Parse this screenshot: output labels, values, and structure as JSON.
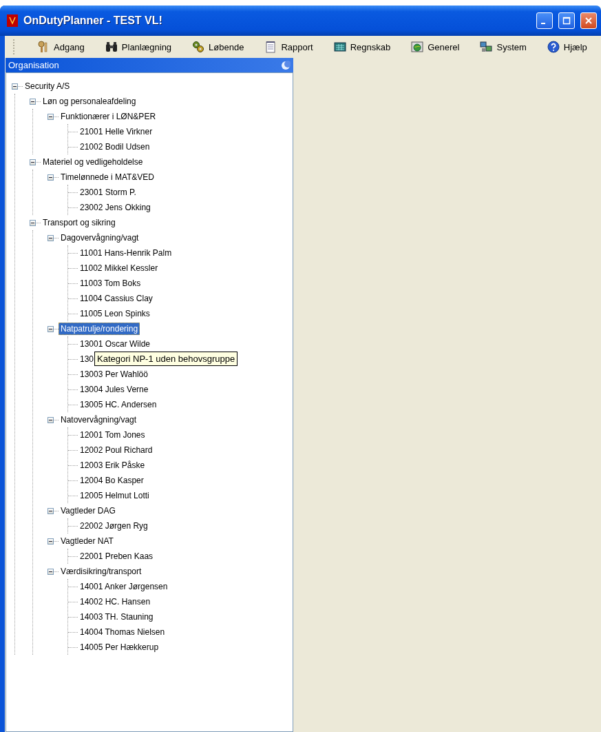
{
  "window": {
    "title": "OnDutyPlanner - TEST VL!"
  },
  "menu": [
    {
      "label": "Adgang"
    },
    {
      "label": "Planlægning"
    },
    {
      "label": "Løbende"
    },
    {
      "label": "Rapport"
    },
    {
      "label": "Regnskab"
    },
    {
      "label": "Generel"
    },
    {
      "label": "System"
    },
    {
      "label": "Hjælp"
    }
  ],
  "panel": {
    "title": "Organisation"
  },
  "tree": [
    {
      "label": "Security A/S",
      "expanded": true,
      "selected": false,
      "children": [
        {
          "label": "Løn og personaleafdeling",
          "expanded": true,
          "selected": false,
          "children": [
            {
              "label": "Funktionærer i LØN&PER",
              "expanded": true,
              "selected": false,
              "children": [
                {
                  "label": "21001 Helle Virkner",
                  "selected": false
                },
                {
                  "label": "21002 Bodil Udsen",
                  "selected": false
                }
              ]
            }
          ]
        },
        {
          "label": "Materiel og vedligeholdelse",
          "expanded": true,
          "selected": false,
          "children": [
            {
              "label": "Timelønnede i MAT&VED",
              "expanded": true,
              "selected": false,
              "children": [
                {
                  "label": "23001 Storm P.",
                  "selected": false
                },
                {
                  "label": "23002 Jens Okking",
                  "selected": false
                }
              ]
            }
          ]
        },
        {
          "label": "Transport og sikring",
          "expanded": true,
          "selected": false,
          "children": [
            {
              "label": "Dagovervågning/vagt",
              "expanded": true,
              "selected": false,
              "children": [
                {
                  "label": "11001 Hans-Henrik Palm",
                  "selected": false
                },
                {
                  "label": "11002 Mikkel Kessler",
                  "selected": false
                },
                {
                  "label": "11003 Tom Boks",
                  "selected": false
                },
                {
                  "label": "11004 Cassius Clay",
                  "selected": false
                },
                {
                  "label": "11005 Leon Spinks",
                  "selected": false
                }
              ]
            },
            {
              "label": "Natpatrulje/rondering",
              "expanded": true,
              "selected": true,
              "children": [
                {
                  "label": "13001 Oscar Wilde",
                  "selected": false
                },
                {
                  "label": "130",
                  "selected": false,
                  "tooltip": "Kategori NP-1 uden behovsgruppe"
                },
                {
                  "label": "13003 Per Wahlöö",
                  "selected": false
                },
                {
                  "label": "13004 Jules Verne",
                  "selected": false
                },
                {
                  "label": "13005 HC. Andersen",
                  "selected": false
                }
              ]
            },
            {
              "label": "Natovervågning/vagt",
              "expanded": true,
              "selected": false,
              "children": [
                {
                  "label": "12001 Tom Jones",
                  "selected": false
                },
                {
                  "label": "12002 Poul Richard",
                  "selected": false
                },
                {
                  "label": "12003 Erik Påske",
                  "selected": false
                },
                {
                  "label": "12004 Bo Kasper",
                  "selected": false
                },
                {
                  "label": "12005 Helmut Lotti",
                  "selected": false
                }
              ]
            },
            {
              "label": "Vagtleder DAG",
              "expanded": true,
              "selected": false,
              "children": [
                {
                  "label": "22002 Jørgen Ryg",
                  "selected": false
                }
              ]
            },
            {
              "label": "Vagtleder NAT",
              "expanded": true,
              "selected": false,
              "children": [
                {
                  "label": "22001 Preben Kaas",
                  "selected": false
                }
              ]
            },
            {
              "label": "Værdisikring/transport",
              "expanded": true,
              "selected": false,
              "children": [
                {
                  "label": "14001 Anker Jørgensen",
                  "selected": false
                },
                {
                  "label": "14002 HC. Hansen",
                  "selected": false
                },
                {
                  "label": "14003 TH. Stauning",
                  "selected": false
                },
                {
                  "label": "14004 Thomas Nielsen",
                  "selected": false
                },
                {
                  "label": "14005 Per Hækkerup",
                  "selected": false
                }
              ]
            }
          ]
        }
      ]
    }
  ]
}
